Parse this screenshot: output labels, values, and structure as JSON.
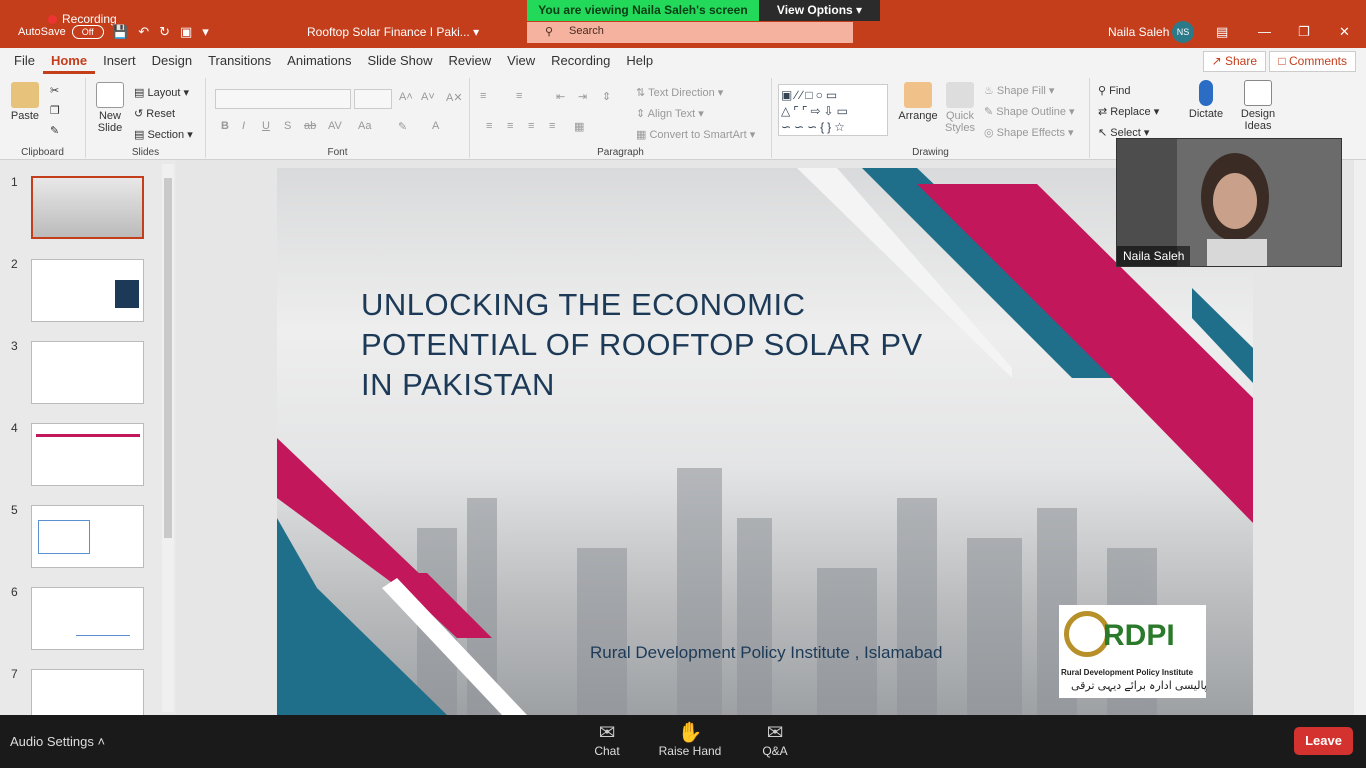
{
  "zoom": {
    "banner": "You are viewing Naila Saleh's screen",
    "view_options": "View Options",
    "recording": "Recording",
    "audio_settings": "Audio Settings",
    "buttons": [
      {
        "label": "Chat",
        "icon": "chat-icon"
      },
      {
        "label": "Raise Hand",
        "icon": "hand-icon"
      },
      {
        "label": "Q&A",
        "icon": "qa-icon"
      }
    ],
    "leave": "Leave",
    "participant_name": "Naila Saleh"
  },
  "titlebar": {
    "autosave": "AutoSave",
    "autosave_state": "Off",
    "doc_title": "Rooftop Solar Finance I Paki...",
    "search_placeholder": "Search",
    "user_name": "Naila Saleh",
    "user_initials": "NS"
  },
  "menu": {
    "tabs": [
      "File",
      "Home",
      "Insert",
      "Design",
      "Transitions",
      "Animations",
      "Slide Show",
      "Review",
      "View",
      "Recording",
      "Help"
    ],
    "active": "Home",
    "share": "Share",
    "comments": "Comments"
  },
  "ribbon": {
    "clipboard": {
      "label": "Clipboard",
      "paste": "Paste"
    },
    "slides": {
      "label": "Slides",
      "new_slide": "New Slide",
      "layout": "Layout",
      "reset": "Reset",
      "section": "Section"
    },
    "font": {
      "label": "Font"
    },
    "paragraph": {
      "label": "Paragraph",
      "text_direction": "Text Direction",
      "align_text": "Align Text",
      "convert_smartart": "Convert to SmartArt"
    },
    "drawing": {
      "label": "Drawing",
      "arrange": "Arrange",
      "quick_styles": "Quick Styles",
      "shape_fill": "Shape Fill",
      "shape_outline": "Shape Outline",
      "shape_effects": "Shape Effects"
    },
    "editing": {
      "find": "Find",
      "replace": "Replace",
      "select": "Select"
    },
    "dictate": "Dictate",
    "design_ideas": "Design Ideas"
  },
  "thumbnails": [
    "1",
    "2",
    "3",
    "4",
    "5",
    "6",
    "7"
  ],
  "slide": {
    "title": "UNLOCKING THE ECONOMIC POTENTIAL OF ROOFTOP SOLAR PV IN PAKISTAN",
    "subtitle": "Rural Development Policy Institute , Islamabad",
    "logo_text": "RDPI",
    "logo_full": "Rural Development Policy Institute",
    "logo_urdu": "پالیسی ادارہ برائے دیہی ترقی"
  },
  "colors": {
    "accent": "#c43e1c",
    "slide_title": "#1c3a57",
    "magenta": "#c2185b",
    "teal": "#1f6f8b"
  }
}
